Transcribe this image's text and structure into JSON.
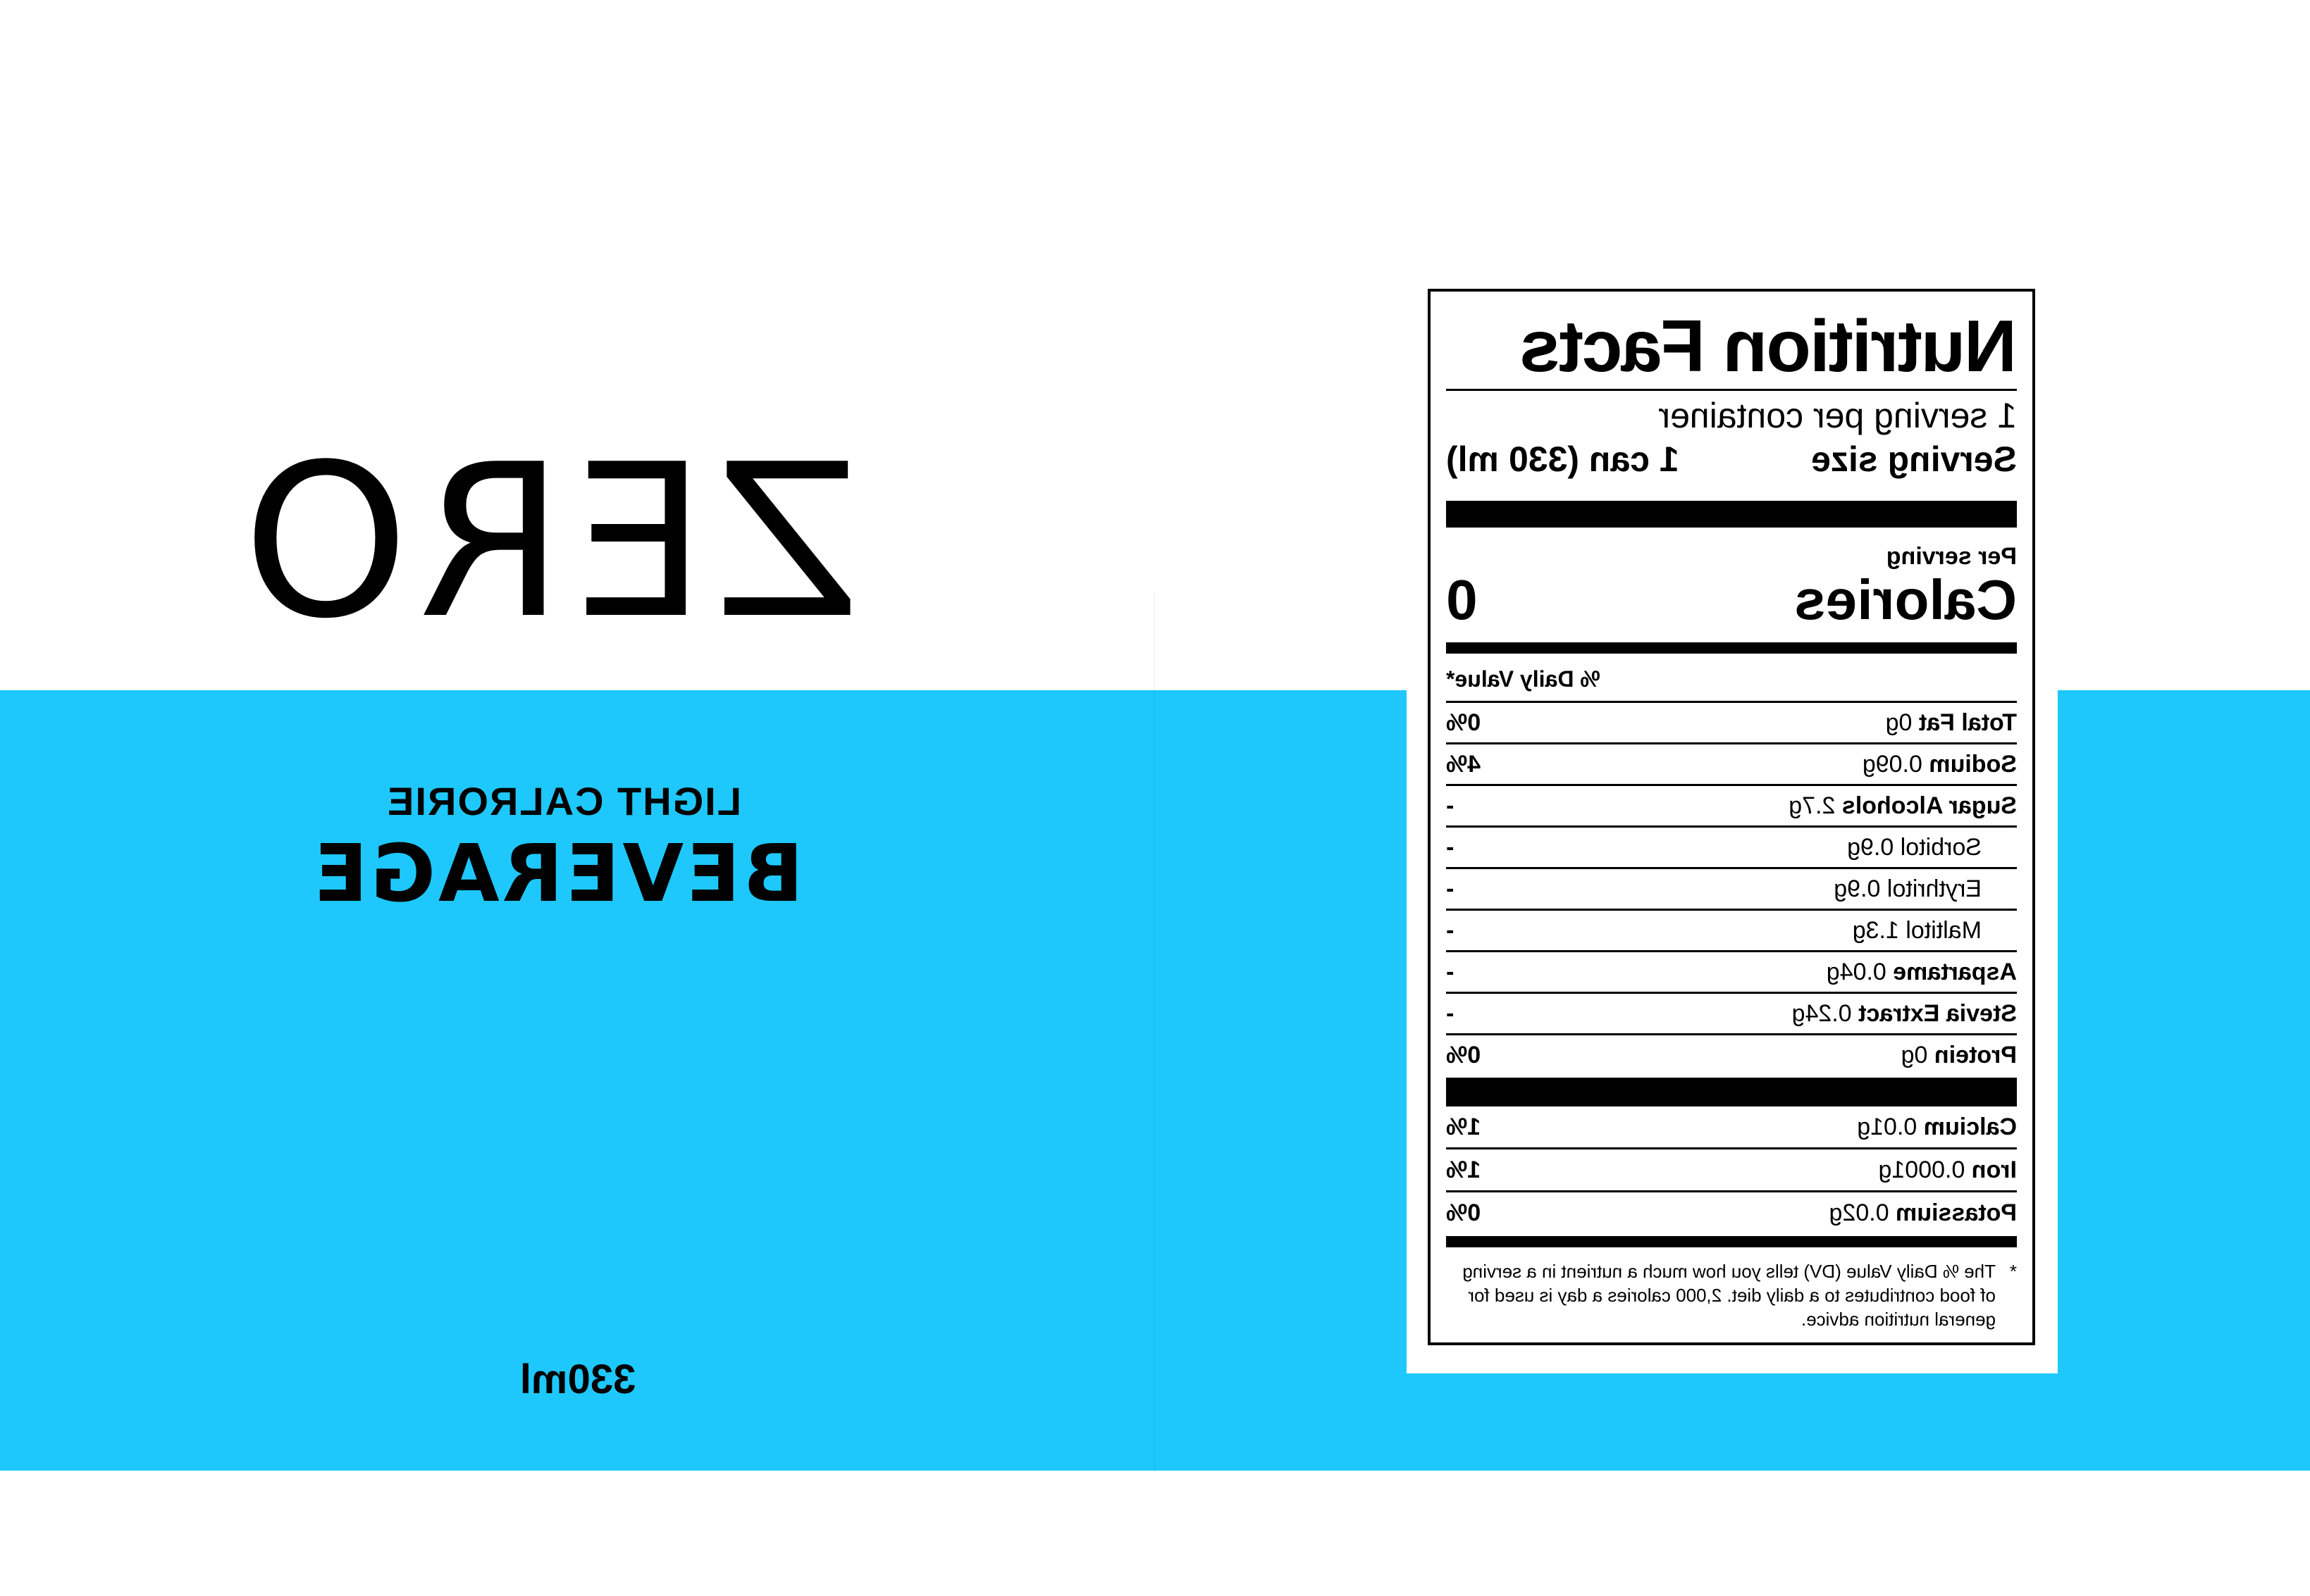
{
  "brand": {
    "name": "ZERO"
  },
  "front": {
    "subtitle": "LIGHT CALRORIE",
    "title": "BEVERAGE",
    "volume": "330ml"
  },
  "colors": {
    "band": "#1ec8fc",
    "text": "#000000",
    "background": "#ffffff"
  },
  "nutrition": {
    "title": "Nutrition Facts",
    "servings_per_container": "1 serving per container",
    "serving_size_label": "Serving size",
    "serving_size_value": "1 can (330 ml)",
    "per_serving": "Per serving",
    "calories_label": "Calories",
    "calories_value": "0",
    "dv_header": "% Daily Value*",
    "rows": [
      {
        "name": "Total Fat",
        "amount": "0g",
        "pct": "0%"
      },
      {
        "name": "Sodium",
        "amount": "0.09g",
        "pct": "4%"
      },
      {
        "name": "Sugar Alcohols",
        "amount": "2.7g",
        "pct": "-"
      },
      {
        "name": "Sorbitol",
        "amount": "0.9g",
        "pct": "-"
      },
      {
        "name": "Erythritol",
        "amount": "0.9g",
        "pct": "-"
      },
      {
        "name": "Maltitol",
        "amount": "1.3g",
        "pct": "-"
      },
      {
        "name": "Aspartame",
        "amount": "0.04g",
        "pct": "-"
      },
      {
        "name": "Stevia Extract",
        "amount": "0.24g",
        "pct": "-"
      },
      {
        "name": "Protein",
        "amount": "0g",
        "pct": "0%"
      }
    ],
    "minerals": [
      {
        "name": "Calcium",
        "amount": "0.01g",
        "pct": "1%"
      },
      {
        "name": "Iron",
        "amount": "0.0001g",
        "pct": "1%"
      },
      {
        "name": "Potassium",
        "amount": "0.02g",
        "pct": "0%"
      }
    ],
    "footnote_star": "*",
    "footnote": "The % Daily Value (DV) tells you how much a nutrient in a serving of food contributes to a daily diet. 2,000 calories a day is used for general nutrition advice."
  }
}
